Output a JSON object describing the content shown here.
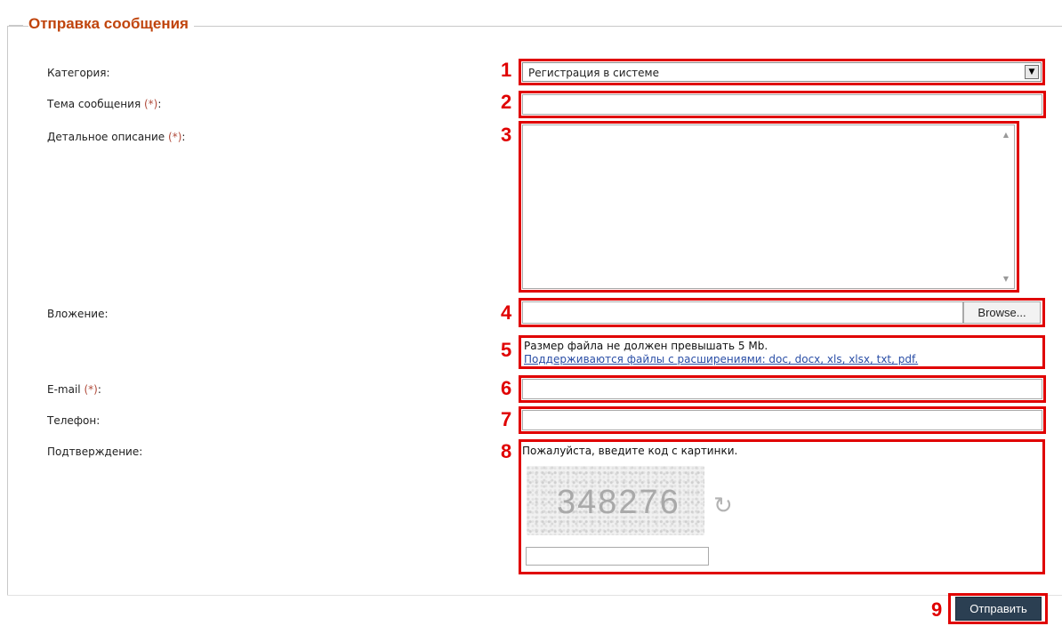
{
  "form": {
    "legend": "Отправка сообщения",
    "labels": {
      "category": "Категория:",
      "subject": "Тема сообщения ",
      "description": "Детальное описание ",
      "attachment": "Вложение:",
      "email": "E-mail ",
      "phone": "Телефон:",
      "confirm": "Подтверждение:"
    },
    "required_mark": "(*)",
    "colon": ":",
    "category_value": "Регистрация в системе",
    "browse_label": "Browse...",
    "file_info_size": "Размер файла не должен превышать 5 Mb.",
    "file_info_types": "Поддерживаются файлы с расширениями: doc, docx, xls, xlsx, txt, pdf.",
    "captcha_prompt": "Пожалуйста, введите код с картинки.",
    "captcha_code": "348276",
    "submit_label": "Отправить"
  },
  "markers": [
    "1",
    "2",
    "3",
    "4",
    "5",
    "6",
    "7",
    "8",
    "9"
  ],
  "icons": {
    "select_arrow": "chevron-down-icon",
    "refresh": "refresh-icon"
  },
  "colors": {
    "legend": "#c0440c",
    "annotation": "#e00000",
    "submit_bg": "#2b3f52",
    "link": "#2a4ea6"
  }
}
